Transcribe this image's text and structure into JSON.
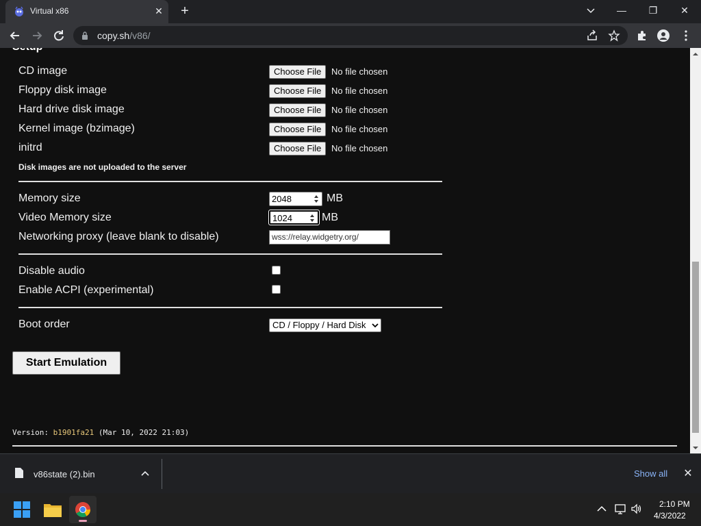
{
  "browser": {
    "tab_title": "Virtual x86",
    "url_host": "copy.sh",
    "url_path": "/v86/",
    "tab_close": "✕",
    "new_tab": "+"
  },
  "window_controls": {
    "minimize": "—",
    "restore": "❐",
    "close": "✕"
  },
  "setup": {
    "heading": "Setup",
    "file_rows": [
      {
        "label": "CD image",
        "button": "Choose File",
        "status": "No file chosen"
      },
      {
        "label": "Floppy disk image",
        "button": "Choose File",
        "status": "No file chosen"
      },
      {
        "label": "Hard drive disk image",
        "button": "Choose File",
        "status": "No file chosen"
      },
      {
        "label": "Kernel image (bzimage)",
        "button": "Choose File",
        "status": "No file chosen"
      },
      {
        "label": "initrd",
        "button": "Choose File",
        "status": "No file chosen"
      }
    ],
    "note": "Disk images are not uploaded to the server",
    "memory_label": "Memory size",
    "memory_value": "2048",
    "memory_unit": "MB",
    "vga_label": "Video Memory size",
    "vga_value": "1024",
    "vga_unit": "MB",
    "proxy_label": "Networking proxy (leave blank to disable)",
    "proxy_value": "wss://relay.widgetry.org/",
    "disable_audio_label": "Disable audio",
    "acpi_label": "Enable ACPI (experimental)",
    "boot_order_label": "Boot order",
    "boot_order_value": "CD / Floppy / Hard Disk",
    "start_button": "Start Emulation",
    "version_prefix": "Version: ",
    "version_hash": "b1901fa21",
    "version_date": " (Mar 10, 2022 21:03)"
  },
  "download_shelf": {
    "file_name": "v86state (2).bin",
    "show_all": "Show all",
    "close": "✕"
  },
  "taskbar": {
    "time": "2:10 PM",
    "date": "4/3/2022"
  }
}
